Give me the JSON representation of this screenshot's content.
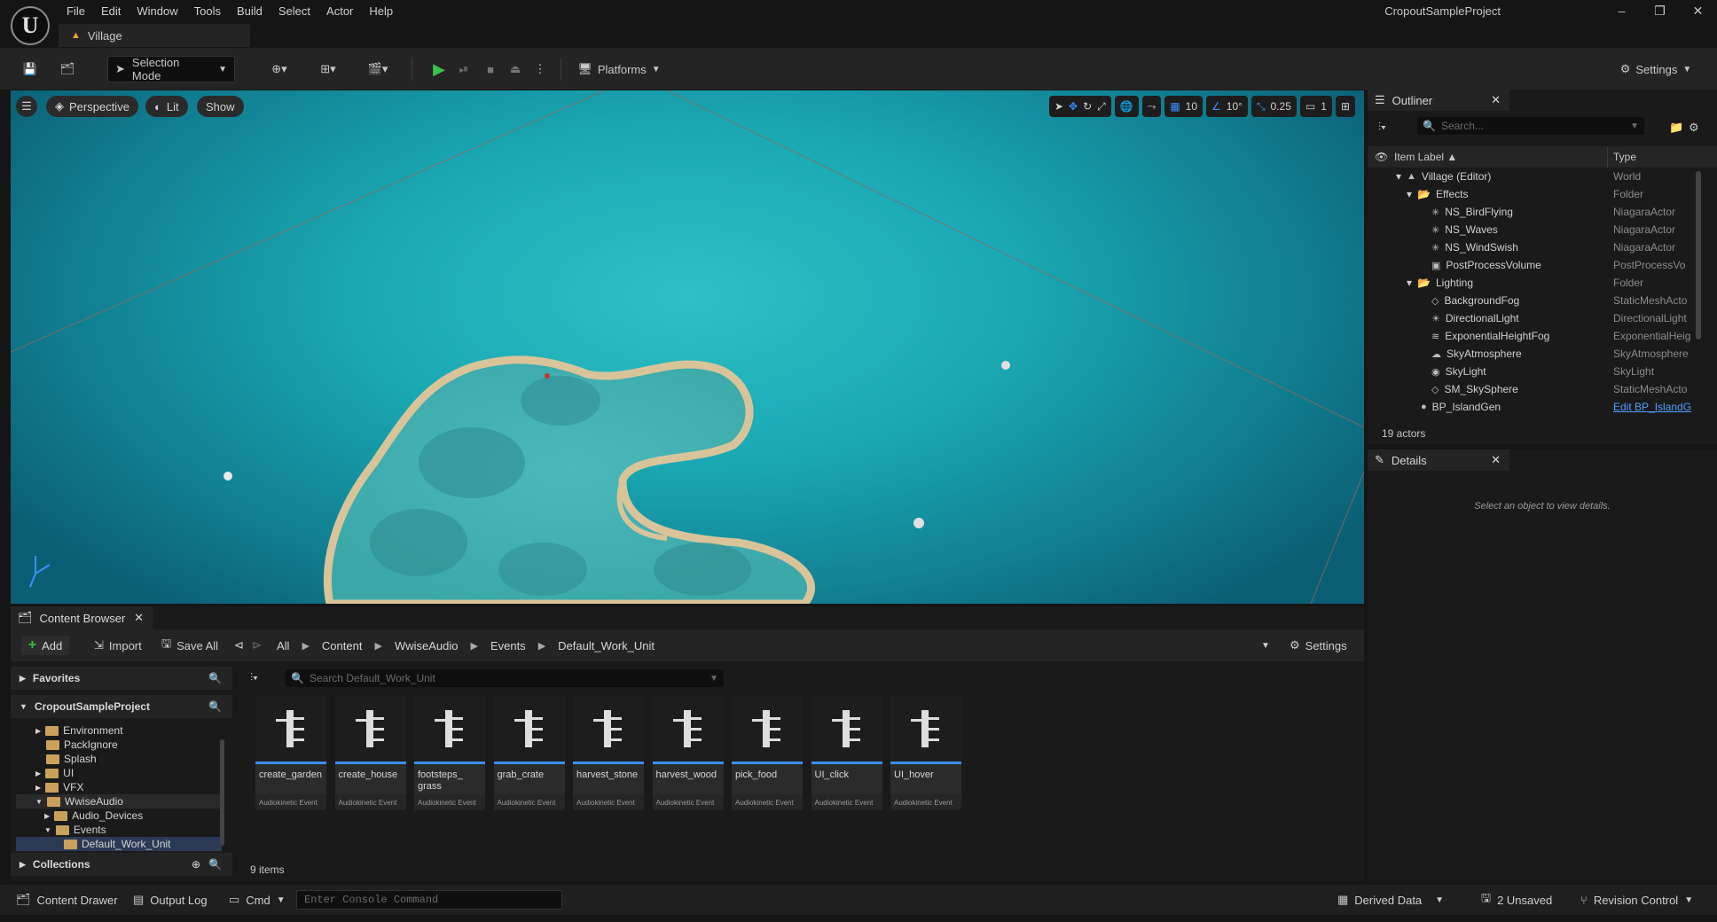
{
  "app": {
    "project_name": "CropoutSampleProject",
    "menu": [
      "File",
      "Edit",
      "Window",
      "Tools",
      "Build",
      "Select",
      "Actor",
      "Help"
    ],
    "map_tab": "Village"
  },
  "toolbar": {
    "selection_mode": "Selection Mode",
    "platforms": "Platforms",
    "settings": "Settings"
  },
  "viewport": {
    "perspective": "Perspective",
    "lit": "Lit",
    "show": "Show",
    "grid_snap": "10",
    "rotation_snap": "10°",
    "scale_snap": "0.25",
    "camera_speed": "1"
  },
  "outliner": {
    "title": "Outliner",
    "search_placeholder": "Search...",
    "col_label": "Item Label ▲",
    "col_type": "Type",
    "rows": [
      {
        "label": "Village (Editor)",
        "type": "World"
      },
      {
        "label": "Effects",
        "type": "Folder"
      },
      {
        "label": "NS_BirdFlying",
        "type": "NiagaraActor"
      },
      {
        "label": "NS_Waves",
        "type": "NiagaraActor"
      },
      {
        "label": "NS_WindSwish",
        "type": "NiagaraActor"
      },
      {
        "label": "PostProcessVolume",
        "type": "PostProcessVo"
      },
      {
        "label": "Lighting",
        "type": "Folder"
      },
      {
        "label": "BackgroundFog",
        "type": "StaticMeshActo"
      },
      {
        "label": "DirectionalLight",
        "type": "DirectionalLight"
      },
      {
        "label": "ExponentialHeightFog",
        "type": "ExponentialHeig"
      },
      {
        "label": "SkyAtmosphere",
        "type": "SkyAtmosphere"
      },
      {
        "label": "SkyLight",
        "type": "SkyLight"
      },
      {
        "label": "SM_SkySphere",
        "type": "StaticMeshActo"
      },
      {
        "label": "BP_IslandGen",
        "type": "Edit BP_IslandG"
      }
    ],
    "count": "19 actors"
  },
  "details": {
    "title": "Details",
    "empty_text": "Select an object to view details."
  },
  "content_browser": {
    "title": "Content Browser",
    "add": "Add",
    "import": "Import",
    "save_all": "Save All",
    "breadcrumbs": [
      "All",
      "Content",
      "WwiseAudio",
      "Events",
      "Default_Work_Unit"
    ],
    "settings": "Settings",
    "favorites": "Favorites",
    "project": "CropoutSampleProject",
    "tree": [
      {
        "label": "Environment"
      },
      {
        "label": "PackIgnore"
      },
      {
        "label": "Splash"
      },
      {
        "label": "UI"
      },
      {
        "label": "VFX"
      },
      {
        "label": "WwiseAudio"
      },
      {
        "label": "Audio_Devices"
      },
      {
        "label": "Events"
      },
      {
        "label": "Default_Work_Unit"
      }
    ],
    "collections": "Collections",
    "search_placeholder": "Search Default_Work_Unit",
    "assets": [
      {
        "name": "create_garden",
        "kind": "Audiokinetic Event"
      },
      {
        "name": "create_house",
        "kind": "Audiokinetic Event"
      },
      {
        "name": "footsteps_ grass",
        "kind": "Audiokinetic Event"
      },
      {
        "name": "grab_crate",
        "kind": "Audiokinetic Event"
      },
      {
        "name": "harvest_stone",
        "kind": "Audiokinetic Event"
      },
      {
        "name": "harvest_wood",
        "kind": "Audiokinetic Event"
      },
      {
        "name": "pick_food",
        "kind": "Audiokinetic Event"
      },
      {
        "name": "UI_click",
        "kind": "Audiokinetic Event"
      },
      {
        "name": "UI_hover",
        "kind": "Audiokinetic Event"
      }
    ],
    "count": "9 items"
  },
  "statusbar": {
    "content_drawer": "Content Drawer",
    "output_log": "Output Log",
    "cmd": "Cmd",
    "console_placeholder": "Enter Console Command",
    "derived_data": "Derived Data",
    "unsaved": "2 Unsaved",
    "revision_control": "Revision Control"
  }
}
